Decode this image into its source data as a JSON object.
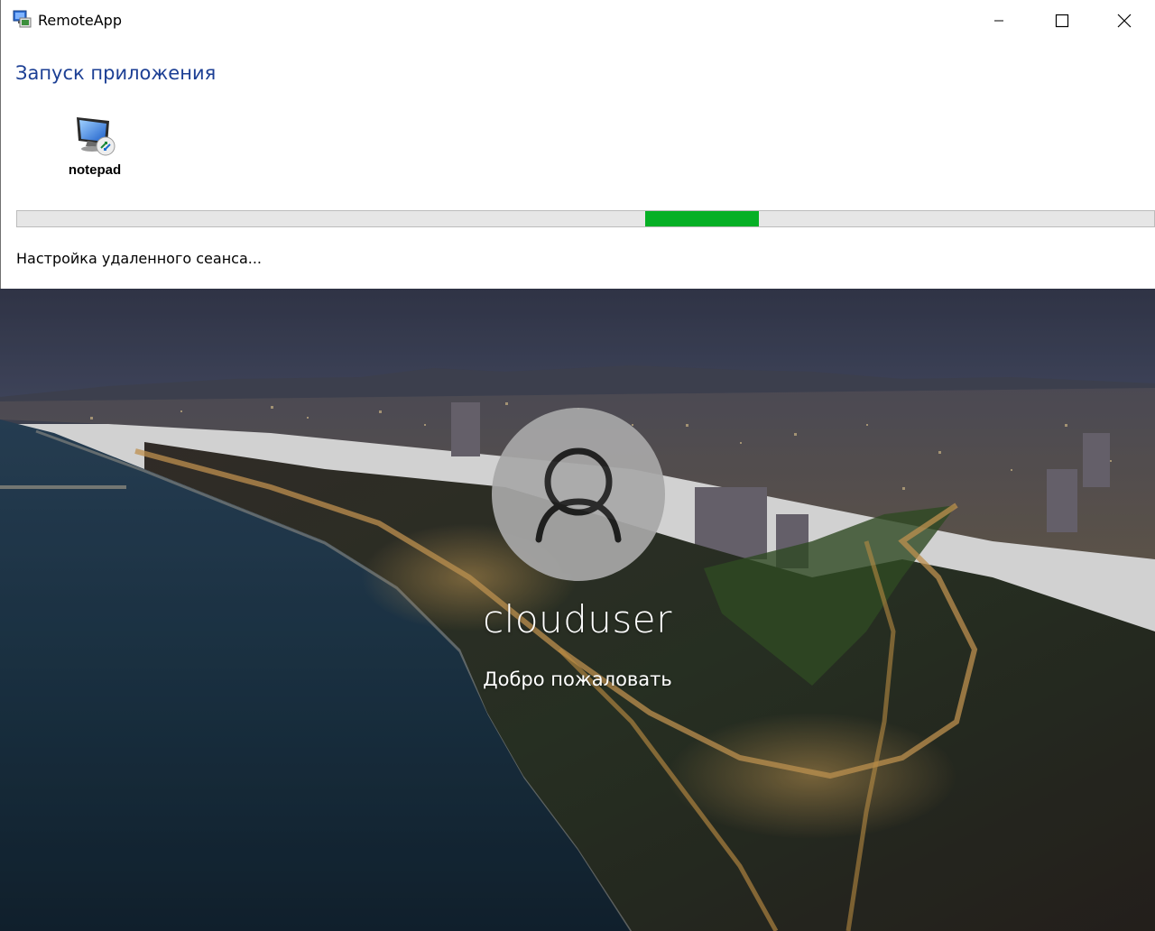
{
  "window": {
    "title": "RemoteApp",
    "controls": {
      "minimize_icon": "minimize-icon",
      "maximize_icon": "maximize-icon",
      "close_icon": "close-icon"
    }
  },
  "launch": {
    "heading": "Запуск приложения",
    "app": {
      "label": "notepad",
      "icon": "remote-desktop-monitor-icon"
    },
    "progress": {
      "mode": "indeterminate-marquee",
      "segment_start": 0.552,
      "segment_end": 0.652,
      "color": "#06b025"
    },
    "status": "Настройка удаленного сеанса..."
  },
  "login": {
    "username": "clouduser",
    "welcome": "Добро пожаловать",
    "avatar_icon": "user-avatar-icon"
  },
  "colors": {
    "heading": "#1c3f94",
    "progress_fill": "#06b025",
    "progress_track": "#e6e6e6"
  }
}
